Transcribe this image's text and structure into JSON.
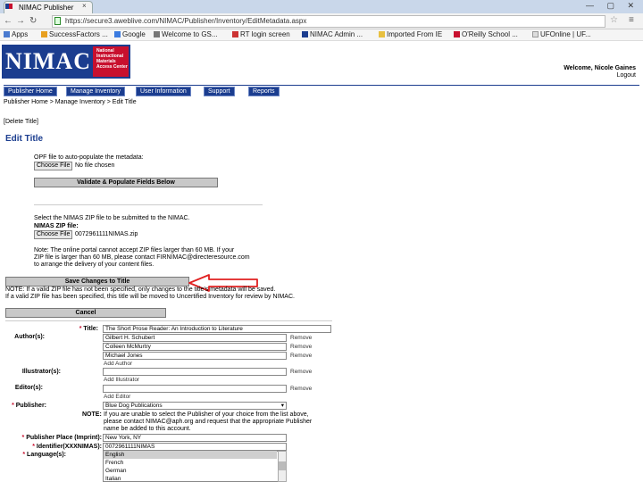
{
  "browser": {
    "tab_title": "NIMAC Publisher",
    "tab_close": "×",
    "window_controls": "— ▢ ✕",
    "url": "https://secure3.aweblive.com/NIMAC/Publisher/Inventory/EditMetadata.aspx",
    "bookmarks": [
      "Apps",
      "SuccessFactors ...",
      "Google",
      "Welcome to GS...",
      "RT login screen",
      "NIMAC Admin ...",
      "Imported From IE",
      "O'Reilly School ...",
      "UFOnline | UF..."
    ]
  },
  "header": {
    "logo_text": "NIMAC",
    "logo_sub": "National Instructional Materials Access Center",
    "welcome": "Welcome, Nicole Gaines",
    "logout": "Logout"
  },
  "nav": {
    "tabs": [
      "Publisher Home",
      "Manage Inventory",
      "User Information",
      "Support",
      "Reports"
    ]
  },
  "breadcrumb": "Publisher Home > Manage Inventory > Edit Title",
  "delete_title": "[Delete Title]",
  "page_title": "Edit Title",
  "opf": {
    "label": "OPF file to auto-populate the metadata:",
    "choose": "Choose File",
    "none": "No file chosen",
    "validate_button": "Validate & Populate Fields Below"
  },
  "zip": {
    "instruction": "Select the NIMAS ZIP file to be submitted to the NIMAC.",
    "label": "NIMAS ZIP file:",
    "choose": "Choose File",
    "filename": "0072961111NIMAS.zip",
    "note_line1": "Note: The online portal cannot accept ZIP files larger than 60 MB. If your",
    "note_line2": "ZIP file is larger than 60 MB, please contact FIRNIMAC@directeresource.com",
    "note_line3": "to arrange the delivery of your content files."
  },
  "save_button": "Save Changes to Title",
  "note_save_line1": "NOTE: If a valid ZIP file has not been specified, only changes to the title's metadata will be saved.",
  "note_save_line2": "If a valid ZIP file has been specified, this title will be moved to Uncertified Inventory for review by NIMAC.",
  "cancel_button": "Cancel",
  "form": {
    "title_label": "Title:",
    "title_value": "The Short Prose Reader: An Introduction to Literature",
    "author_label": "Author(s):",
    "authors": [
      "Gilbert H. Schubert",
      "Colleen McMurtry",
      "Michael Jones"
    ],
    "remove": "Remove",
    "add_author": "Add Author",
    "illustrator_label": "Illustrator(s):",
    "add_illustrator": "Add Illustrator",
    "editor_label": "Editor(s):",
    "add_editor": "Add Editor",
    "publisher_label": "Publisher:",
    "publisher_value": "Blue Dog Publications",
    "publisher_note_lead": "NOTE:",
    "publisher_note_line1": "If you are unable to select the Publisher of your choice from the list above,",
    "publisher_note_line2": "please contact NIMAC@aph.org and request that the appropriate Publisher",
    "publisher_note_line3": "name be added to this account.",
    "place_label": "Publisher Place (Imprint):",
    "place_value": "New York, NY",
    "identifier_label": "Identifier(XXXNIMAS):",
    "identifier_value": "0072961111NIMAS",
    "language_label": "Language(s):",
    "languages": [
      "English",
      "French",
      "German",
      "Italian"
    ]
  },
  "colors": {
    "brand_blue": "#1b3d8f",
    "brand_red": "#c8102e",
    "button_gray": "#c8c8c8",
    "annotation_red": "#e02020"
  }
}
